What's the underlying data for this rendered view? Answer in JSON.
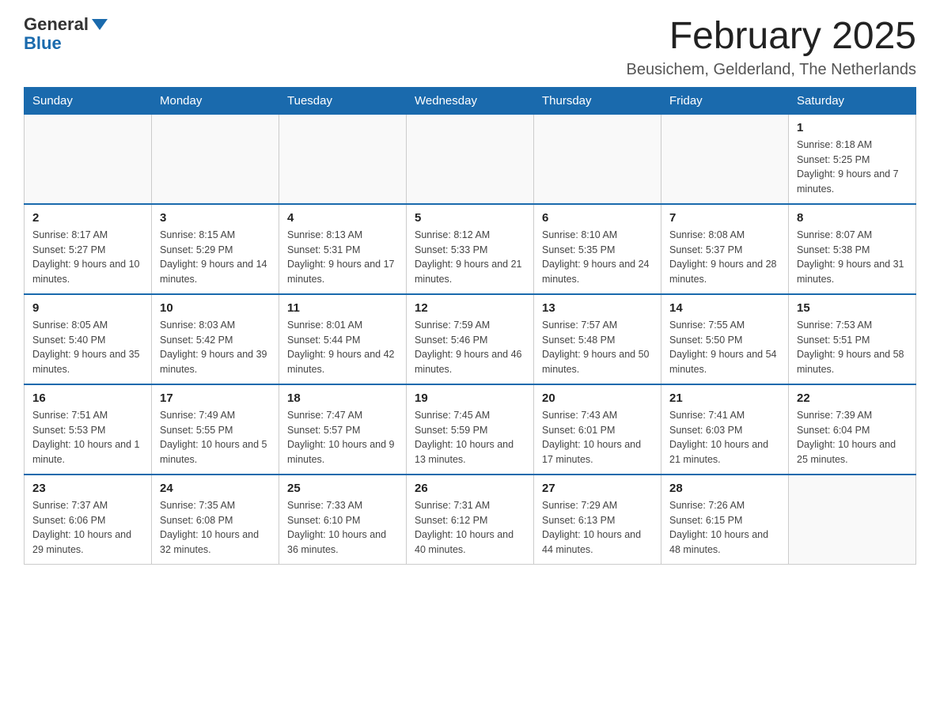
{
  "header": {
    "logo": {
      "general": "General",
      "blue": "Blue"
    },
    "title": "February 2025",
    "subtitle": "Beusichem, Gelderland, The Netherlands"
  },
  "weekdays": [
    "Sunday",
    "Monday",
    "Tuesday",
    "Wednesday",
    "Thursday",
    "Friday",
    "Saturday"
  ],
  "weeks": [
    [
      {
        "day": "",
        "detail": ""
      },
      {
        "day": "",
        "detail": ""
      },
      {
        "day": "",
        "detail": ""
      },
      {
        "day": "",
        "detail": ""
      },
      {
        "day": "",
        "detail": ""
      },
      {
        "day": "",
        "detail": ""
      },
      {
        "day": "1",
        "detail": "Sunrise: 8:18 AM\nSunset: 5:25 PM\nDaylight: 9 hours and 7 minutes."
      }
    ],
    [
      {
        "day": "2",
        "detail": "Sunrise: 8:17 AM\nSunset: 5:27 PM\nDaylight: 9 hours and 10 minutes."
      },
      {
        "day": "3",
        "detail": "Sunrise: 8:15 AM\nSunset: 5:29 PM\nDaylight: 9 hours and 14 minutes."
      },
      {
        "day": "4",
        "detail": "Sunrise: 8:13 AM\nSunset: 5:31 PM\nDaylight: 9 hours and 17 minutes."
      },
      {
        "day": "5",
        "detail": "Sunrise: 8:12 AM\nSunset: 5:33 PM\nDaylight: 9 hours and 21 minutes."
      },
      {
        "day": "6",
        "detail": "Sunrise: 8:10 AM\nSunset: 5:35 PM\nDaylight: 9 hours and 24 minutes."
      },
      {
        "day": "7",
        "detail": "Sunrise: 8:08 AM\nSunset: 5:37 PM\nDaylight: 9 hours and 28 minutes."
      },
      {
        "day": "8",
        "detail": "Sunrise: 8:07 AM\nSunset: 5:38 PM\nDaylight: 9 hours and 31 minutes."
      }
    ],
    [
      {
        "day": "9",
        "detail": "Sunrise: 8:05 AM\nSunset: 5:40 PM\nDaylight: 9 hours and 35 minutes."
      },
      {
        "day": "10",
        "detail": "Sunrise: 8:03 AM\nSunset: 5:42 PM\nDaylight: 9 hours and 39 minutes."
      },
      {
        "day": "11",
        "detail": "Sunrise: 8:01 AM\nSunset: 5:44 PM\nDaylight: 9 hours and 42 minutes."
      },
      {
        "day": "12",
        "detail": "Sunrise: 7:59 AM\nSunset: 5:46 PM\nDaylight: 9 hours and 46 minutes."
      },
      {
        "day": "13",
        "detail": "Sunrise: 7:57 AM\nSunset: 5:48 PM\nDaylight: 9 hours and 50 minutes."
      },
      {
        "day": "14",
        "detail": "Sunrise: 7:55 AM\nSunset: 5:50 PM\nDaylight: 9 hours and 54 minutes."
      },
      {
        "day": "15",
        "detail": "Sunrise: 7:53 AM\nSunset: 5:51 PM\nDaylight: 9 hours and 58 minutes."
      }
    ],
    [
      {
        "day": "16",
        "detail": "Sunrise: 7:51 AM\nSunset: 5:53 PM\nDaylight: 10 hours and 1 minute."
      },
      {
        "day": "17",
        "detail": "Sunrise: 7:49 AM\nSunset: 5:55 PM\nDaylight: 10 hours and 5 minutes."
      },
      {
        "day": "18",
        "detail": "Sunrise: 7:47 AM\nSunset: 5:57 PM\nDaylight: 10 hours and 9 minutes."
      },
      {
        "day": "19",
        "detail": "Sunrise: 7:45 AM\nSunset: 5:59 PM\nDaylight: 10 hours and 13 minutes."
      },
      {
        "day": "20",
        "detail": "Sunrise: 7:43 AM\nSunset: 6:01 PM\nDaylight: 10 hours and 17 minutes."
      },
      {
        "day": "21",
        "detail": "Sunrise: 7:41 AM\nSunset: 6:03 PM\nDaylight: 10 hours and 21 minutes."
      },
      {
        "day": "22",
        "detail": "Sunrise: 7:39 AM\nSunset: 6:04 PM\nDaylight: 10 hours and 25 minutes."
      }
    ],
    [
      {
        "day": "23",
        "detail": "Sunrise: 7:37 AM\nSunset: 6:06 PM\nDaylight: 10 hours and 29 minutes."
      },
      {
        "day": "24",
        "detail": "Sunrise: 7:35 AM\nSunset: 6:08 PM\nDaylight: 10 hours and 32 minutes."
      },
      {
        "day": "25",
        "detail": "Sunrise: 7:33 AM\nSunset: 6:10 PM\nDaylight: 10 hours and 36 minutes."
      },
      {
        "day": "26",
        "detail": "Sunrise: 7:31 AM\nSunset: 6:12 PM\nDaylight: 10 hours and 40 minutes."
      },
      {
        "day": "27",
        "detail": "Sunrise: 7:29 AM\nSunset: 6:13 PM\nDaylight: 10 hours and 44 minutes."
      },
      {
        "day": "28",
        "detail": "Sunrise: 7:26 AM\nSunset: 6:15 PM\nDaylight: 10 hours and 48 minutes."
      },
      {
        "day": "",
        "detail": ""
      }
    ]
  ]
}
